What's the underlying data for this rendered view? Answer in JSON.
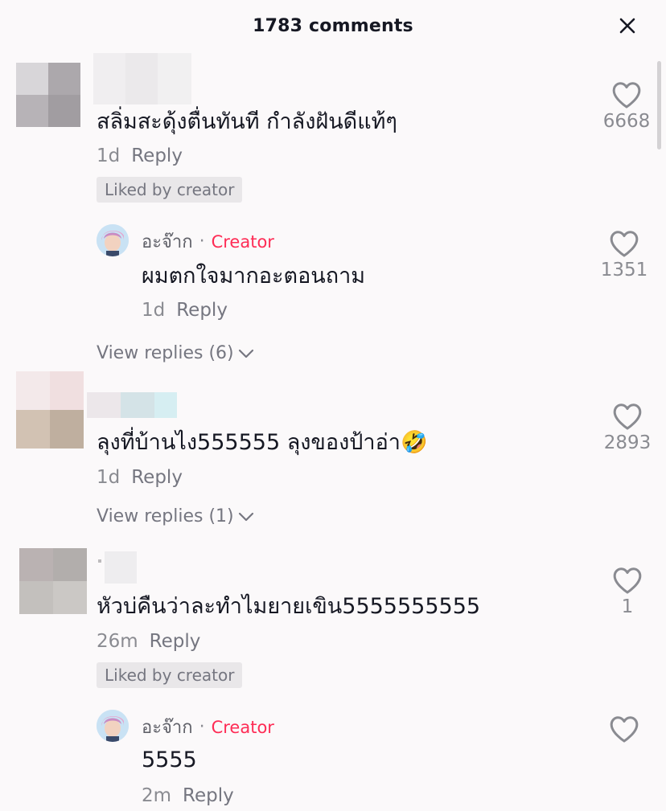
{
  "header": {
    "title": "1783 comments",
    "close_icon": "close-icon"
  },
  "comments": [
    {
      "text": "สลิ่มสะดุ้งตื่นทันที กำลังฝันดีแท้ๆ",
      "time": "1d",
      "reply_label": "Reply",
      "badge": "Liked by creator",
      "likes": "6668",
      "reply": {
        "author": "อะจ๊าก",
        "dot": "·",
        "tag": "Creator",
        "text": "ผมตกใจมากอะตอนถาม",
        "time": "1d",
        "reply_label": "Reply",
        "likes": "1351"
      },
      "view_replies": "View replies (6)"
    },
    {
      "text": "ลุงที่บ้านไง555555 ลุงของป้าอ่า🤣",
      "time": "1d",
      "reply_label": "Reply",
      "likes": "2893",
      "view_replies": "View replies (1)"
    },
    {
      "text": "หัวบ่คืนว่าละทำไมยายเขิน5555555555",
      "time": "26m",
      "reply_label": "Reply",
      "badge": "Liked by creator",
      "likes": "1",
      "reply": {
        "author": "อะจ๊าก",
        "dot": "·",
        "tag": "Creator",
        "text": "5555",
        "time": "2m",
        "reply_label": "Reply"
      }
    }
  ],
  "icons": {
    "like": "heart-outline-icon",
    "chevron": "chevron-down-icon"
  },
  "colors": {
    "creator_tag": "#fe2c55",
    "secondary_text": "#8a8b91",
    "badge_bg": "#e9e7e9"
  }
}
